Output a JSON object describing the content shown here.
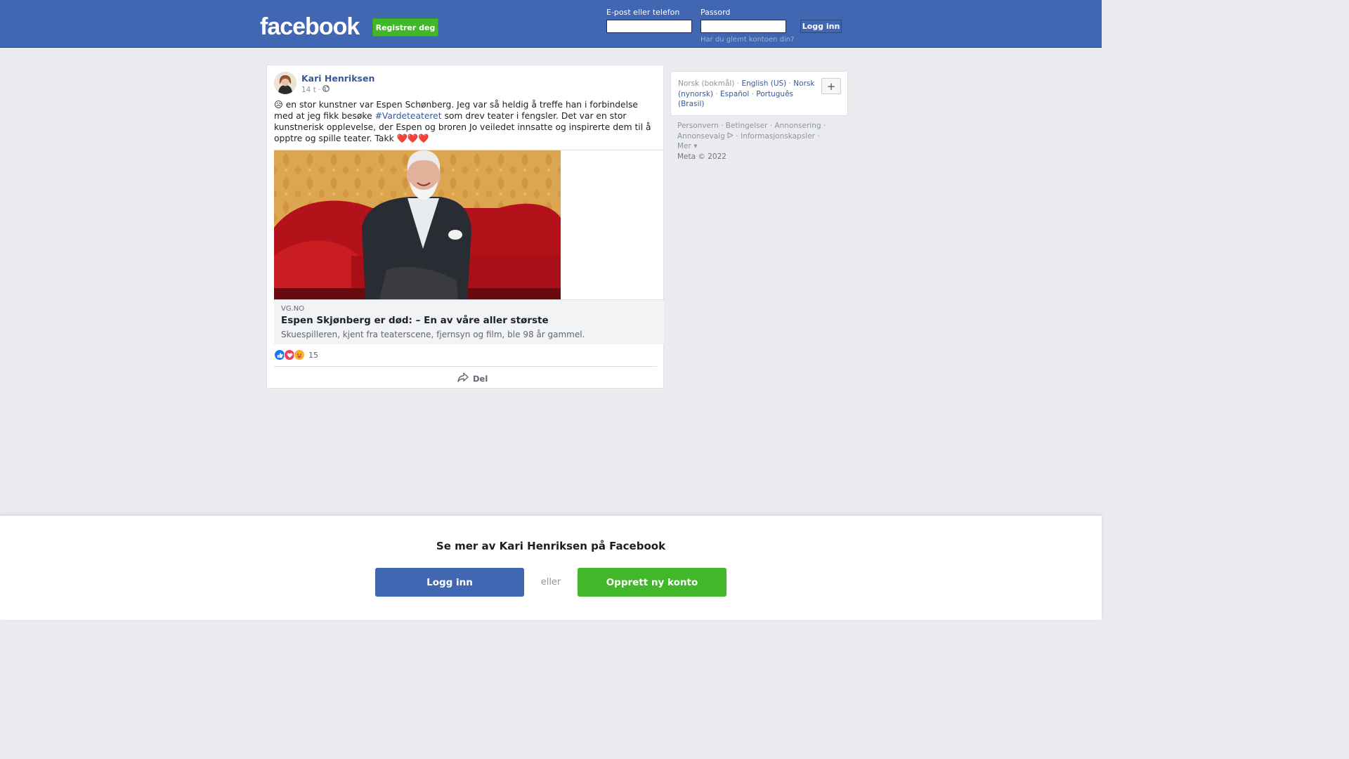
{
  "header": {
    "logo": "facebook",
    "register_label": "Registrer deg",
    "email_label": "E-post eller telefon",
    "email_value": "",
    "password_label": "Passord",
    "password_value": "",
    "login_label": "Logg inn",
    "forgot_label": "Har du glemt kontoen din?"
  },
  "post": {
    "author": "Kari Henriksen",
    "time": "14 t",
    "separator": "·",
    "text_emoji": "😥",
    "text_before": " en stor kunstner var Espen Schønberg. Jeg var så heldig å treffe han i forbindelse med at jeg fikk besøke ",
    "hashtag": "#Vardeteateret",
    "text_after": " som drev teater i fengsler. Det var en stor kunstnerisk opplevelse, der Espen og broren Jo veiledet innsatte og inspirerte dem til å opptre og spille teater. Takk ❤️❤️❤️",
    "link": {
      "domain": "VG.NO",
      "title": "Espen Skjønberg er død: – En av våre aller største",
      "description": "Skuespilleren, kjent fra teaterscene, fjernsyn og film, ble 98 år gammel."
    },
    "reactions_count": "15",
    "share_label": "Del"
  },
  "sidebar": {
    "current_language": "Norsk (bokmål)",
    "languages": [
      "English (US)",
      "Norsk (nynorsk)",
      "Español",
      "Português (Brasil)"
    ],
    "dot": "·",
    "more_languages": "+",
    "footer": {
      "privacy": "Personvern",
      "terms": "Betingelser",
      "advertising": "Annonsering",
      "ad_choices": "Annonsevalg",
      "cookies": "Informasjonskapsler",
      "more": "Mer",
      "copyright": "Meta © 2022"
    }
  },
  "overlay": {
    "title": "Se mer av Kari Henriksen på Facebook",
    "login_label": "Logg inn",
    "or_label": "eller",
    "create_label": "Opprett ny konto"
  },
  "colors": {
    "brand_blue": "#4267b2",
    "green": "#42b72a",
    "link": "#385898"
  },
  "icons": [
    "globe-icon",
    "like-icon",
    "love-icon",
    "care-icon",
    "share-arrow-icon",
    "ad-choices-icon"
  ]
}
